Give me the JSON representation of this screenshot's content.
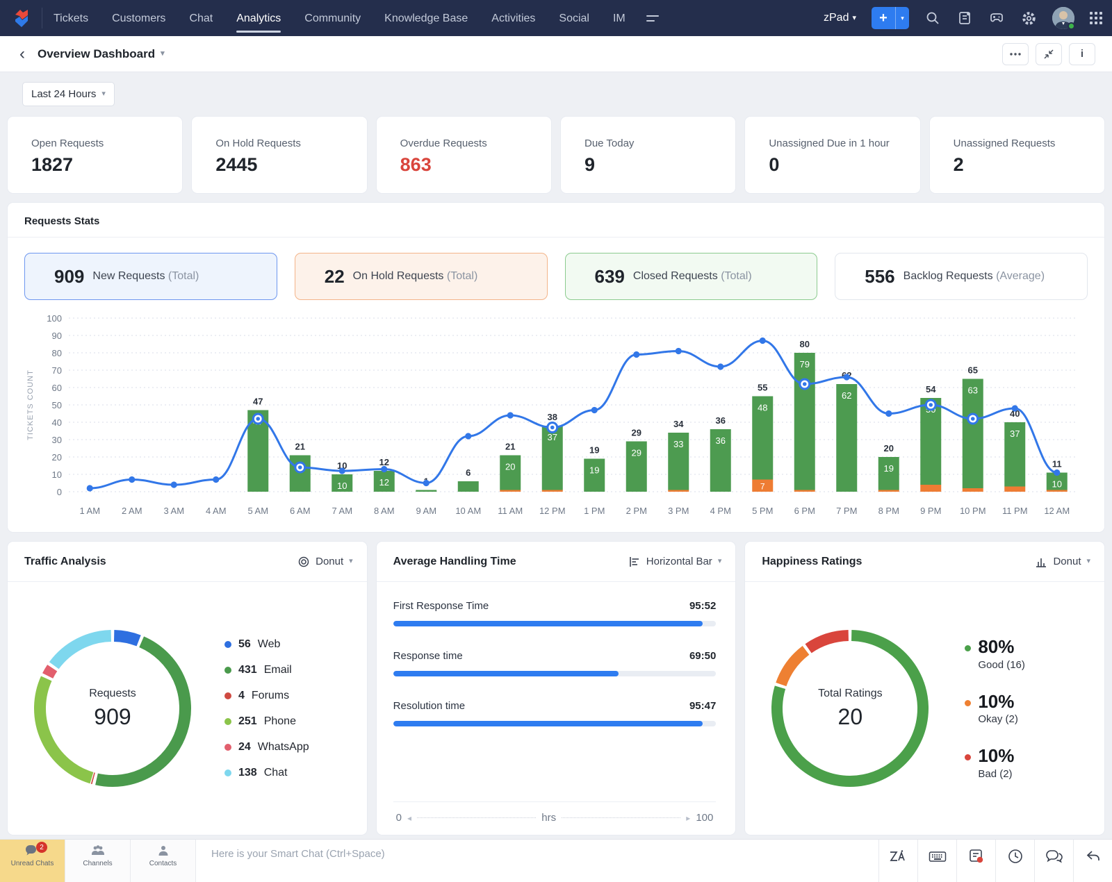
{
  "navbar": {
    "items": [
      "Tickets",
      "Customers",
      "Chat",
      "Analytics",
      "Community",
      "Knowledge Base",
      "Activities",
      "Social",
      "IM"
    ],
    "active": "Analytics",
    "workspace": "zPad"
  },
  "header": {
    "title": "Overview Dashboard"
  },
  "filter": {
    "range": "Last 24 Hours"
  },
  "kpis": [
    {
      "label": "Open Requests",
      "value": "1827"
    },
    {
      "label": "On Hold Requests",
      "value": "2445"
    },
    {
      "label": "Overdue Requests",
      "value": "863",
      "color": "#d9453c"
    },
    {
      "label": "Due Today",
      "value": "9"
    },
    {
      "label": "Unassigned Due in 1 hour",
      "value": "0"
    },
    {
      "label": "Unassigned Requests",
      "value": "2"
    }
  ],
  "requests_stats": {
    "title": "Requests Stats",
    "pills": [
      {
        "value": "909",
        "label": "New Requests",
        "suffix": "(Total)"
      },
      {
        "value": "22",
        "label": "On Hold Requests",
        "suffix": "(Total)"
      },
      {
        "value": "639",
        "label": "Closed Requests",
        "suffix": "(Total)"
      },
      {
        "value": "556",
        "label": "Backlog Requests",
        "suffix": "(Average)"
      }
    ]
  },
  "chart_data": [
    {
      "id": "requests-stats-combo",
      "type": "bar+line",
      "ylabel": "TICKETS COUNT",
      "ylim": [
        0,
        100
      ],
      "ytick_step": 10,
      "grid": true,
      "categories": [
        "1 AM",
        "2 AM",
        "3 AM",
        "4 AM",
        "5 AM",
        "6 AM",
        "7 AM",
        "8 AM",
        "9 AM",
        "10 AM",
        "11 AM",
        "12 PM",
        "1 PM",
        "2 PM",
        "3 PM",
        "4 PM",
        "5 PM",
        "6 PM",
        "7 PM",
        "8 PM",
        "9 PM",
        "10 PM",
        "11 PM",
        "12 AM"
      ],
      "series": [
        {
          "name": "closed-bar",
          "type": "bar",
          "color": "#4d9b50",
          "values": [
            0,
            0,
            0,
            0,
            47,
            21,
            10,
            12,
            1,
            6,
            20,
            37,
            19,
            29,
            33,
            36,
            48,
            79,
            62,
            19,
            50,
            63,
            37,
            10
          ]
        },
        {
          "name": "onhold-bar",
          "type": "bar",
          "color": "#ee7c33",
          "values": [
            0,
            0,
            0,
            0,
            0,
            0,
            0,
            0,
            0,
            0,
            1,
            1,
            0,
            0,
            1,
            0,
            7,
            1,
            0,
            1,
            4,
            2,
            3,
            1
          ]
        },
        {
          "name": "new-line",
          "type": "line",
          "color": "#3277e8",
          "values": [
            2,
            7,
            4,
            7,
            42,
            14,
            12,
            13,
            5,
            32,
            44,
            37,
            47,
            79,
            81,
            72,
            87,
            62,
            66,
            45,
            50,
            42,
            48,
            11
          ],
          "ring_points": [
            4,
            5,
            11,
            17,
            20,
            21
          ]
        }
      ]
    },
    {
      "id": "traffic-analysis",
      "type": "donut",
      "title": "Traffic Analysis",
      "chart_type_label": "Donut",
      "center": {
        "label": "Requests",
        "value": "909"
      },
      "slices": [
        {
          "label": "Web",
          "value": 56,
          "color": "#2e6fe0"
        },
        {
          "label": "Email",
          "value": 431,
          "color": "#4a9a4c"
        },
        {
          "label": "Forums",
          "value": 4,
          "color": "#cf4a41"
        },
        {
          "label": "Phone",
          "value": 251,
          "color": "#8bc44a"
        },
        {
          "label": "WhatsApp",
          "value": 24,
          "color": "#e25f6d"
        },
        {
          "label": "Chat",
          "value": 138,
          "color": "#7ed7ee"
        }
      ],
      "legend_order": [
        0,
        1,
        2,
        3,
        4,
        5
      ]
    },
    {
      "id": "average-handling-time",
      "type": "hbar",
      "title": "Average Handling Time",
      "chart_type_label": "Horizontal Bar",
      "bar_color": "#2e7cf0",
      "rows": [
        {
          "label": "First Response Time",
          "value": "95:52",
          "pct": 95.9
        },
        {
          "label": "Response time",
          "value": "69:50",
          "pct": 69.8
        },
        {
          "label": "Resolution time",
          "value": "95:47",
          "pct": 95.8
        }
      ],
      "axis": {
        "min": "0",
        "unit": "hrs",
        "max": "100"
      }
    },
    {
      "id": "happiness-ratings",
      "type": "donut",
      "title": "Happiness Ratings",
      "chart_type_label": "Donut",
      "center": {
        "label": "Total Ratings",
        "value": "20"
      },
      "slices": [
        {
          "label": "Good (16)",
          "pct": "80%",
          "value": 16,
          "color": "#4ba04a"
        },
        {
          "label": "Okay (2)",
          "pct": "10%",
          "value": 2,
          "color": "#ee8032"
        },
        {
          "label": "Bad (2)",
          "pct": "10%",
          "value": 2,
          "color": "#d9453c"
        }
      ]
    }
  ],
  "footer": {
    "tabs": [
      {
        "label": "Unread Chats",
        "badge": "2"
      },
      {
        "label": "Channels"
      },
      {
        "label": "Contacts"
      }
    ],
    "smart_chat_placeholder": "Here is your Smart Chat (Ctrl+Space)"
  }
}
